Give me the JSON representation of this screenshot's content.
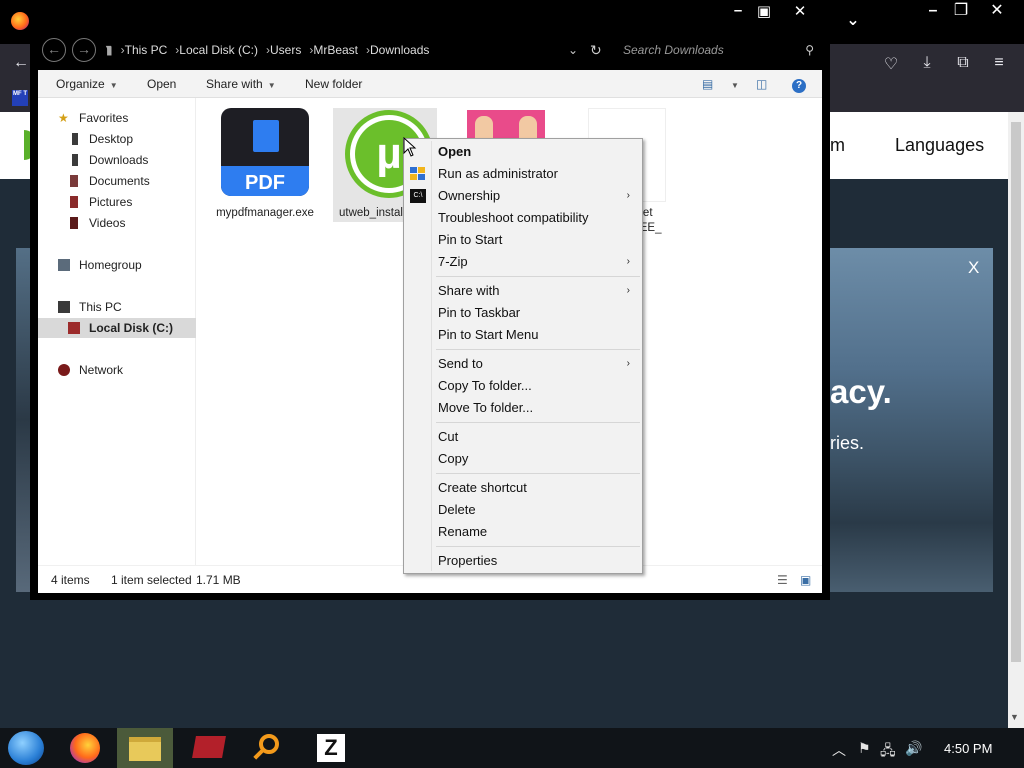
{
  "browser": {
    "site_nav": [
      "m",
      "Languages"
    ],
    "hero_title": "acy.",
    "hero_subtitle": "ries.",
    "hero_close": "X",
    "bookmark_badge": "MF T"
  },
  "explorer": {
    "address": {
      "crumbs": [
        "This PC",
        "Local Disk (C:)",
        "Users",
        "MrBeast",
        "Downloads"
      ],
      "search_placeholder": "Search Downloads"
    },
    "toolbar": {
      "organize": "Organize",
      "open": "Open",
      "share_with": "Share with",
      "new_folder": "New folder"
    },
    "nav": {
      "favorites": "Favorites",
      "desktop": "Desktop",
      "downloads": "Downloads",
      "documents": "Documents",
      "pictures": "Pictures",
      "videos": "Videos",
      "homegroup": "Homegroup",
      "this_pc": "This PC",
      "local_disk": "Local Disk (C:)",
      "network": "Network"
    },
    "files": [
      {
        "name": "mypdfmanager.exe",
        "icon_text": "PDF"
      },
      {
        "name": "utweb_install",
        "icon_text": ""
      },
      {
        "name": "",
        "icon_text": ""
      },
      {
        "name": "NGSet\n_FREE_\nexe",
        "icon_text": ""
      }
    ],
    "status": {
      "count": "4 items",
      "selected": "1 item selected",
      "size": "1.71 MB"
    }
  },
  "context_menu": {
    "items": [
      {
        "label": "Open",
        "bold": true
      },
      {
        "label": "Run as administrator",
        "icon": "shield-icon"
      },
      {
        "label": "Ownership",
        "submenu": true
      },
      {
        "label": "Troubleshoot compatibility"
      },
      {
        "label": "Pin to Start"
      },
      {
        "label": "7-Zip",
        "submenu": true
      },
      {
        "label": "Share with",
        "submenu": true
      },
      {
        "label": "Pin to Taskbar"
      },
      {
        "label": "Pin to Start Menu"
      },
      {
        "label": "Send to",
        "submenu": true
      },
      {
        "label": "Copy To folder..."
      },
      {
        "label": "Move To folder..."
      },
      {
        "label": "Cut"
      },
      {
        "label": "Copy"
      },
      {
        "label": "Create shortcut"
      },
      {
        "label": "Delete"
      },
      {
        "label": "Rename"
      },
      {
        "label": "Properties"
      }
    ],
    "submenu_arrow": "›"
  },
  "taskbar": {
    "clock": "4:50 PM",
    "apps": [
      "start-orb",
      "firefox",
      "file-explorer",
      "media-app",
      "search-tool",
      "z-app"
    ]
  },
  "colors": {
    "accent_selected": "#e5e5e5",
    "menu_bg": "#f2f2f2",
    "taskbar_bg": "#101418",
    "utorrent_green": "#6bbf2b"
  }
}
